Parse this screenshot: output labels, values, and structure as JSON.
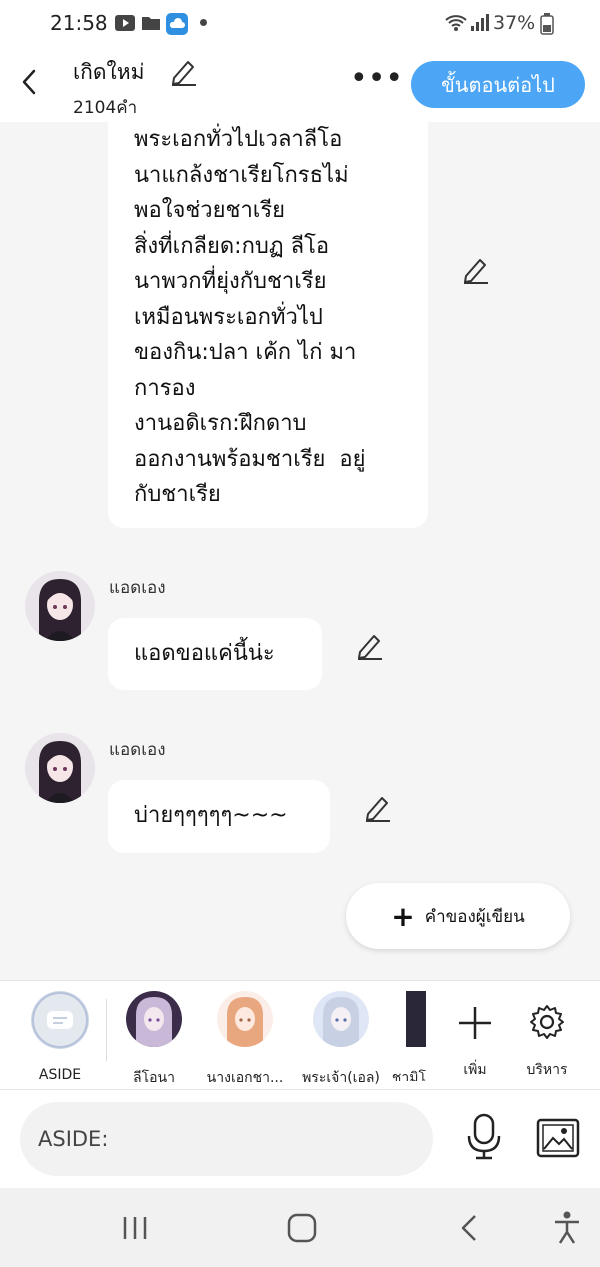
{
  "status_bar": {
    "time": "21:58",
    "battery": "37%",
    "icons": [
      "youtube-icon",
      "folder-icon",
      "cloud-icon",
      "wifi-icon",
      "signal-icon",
      "battery-icon"
    ]
  },
  "header": {
    "title": "เกิดใหม่",
    "count": "2104คำ",
    "more_label": "•••",
    "next_button": "ขั้นตอนต่อไป"
  },
  "messages": [
    {
      "text": "พระเอกทั่วไปเวลาลีโอ\nนาแกล้งชาเรียโกรธไม่\nพอใจช่วยชาเรีย\nสิ่งที่เกลียด:กบฏ ลีโอ\nนาพวกที่ยุ่งกับชาเรีย\nเหมือนพระเอกทั่วไป\nของกิน:ปลา เค้ก ไก่ มา\nการอง\nงานอดิเรก:ฝึกดาบ\nออกงานพร้อมชาเรีย  อยู่\nกับชาเรีย"
    },
    {
      "sender": "แอดเอง",
      "text": "แอดขอแค่นี้น่ะ"
    },
    {
      "sender": "แอดเอง",
      "text": "บ่ายๆๆๆๆๆ~~~"
    }
  ],
  "add_comment": {
    "label": "คำของผู้เขียน"
  },
  "characters": [
    {
      "label": "ASIDE"
    },
    {
      "label": "ลีโอนา"
    },
    {
      "label": "นางเอกชา..."
    },
    {
      "label": "พระเจ้า(เอล)"
    },
    {
      "label": "ชามิโ"
    }
  ],
  "char_actions": {
    "add_label": "เพิ่ม",
    "manage_label": "บริหาร"
  },
  "input": {
    "placeholder": "ASIDE:"
  },
  "colors": {
    "accent": "#4ca6f5",
    "background": "#f5f5f5",
    "bubble": "#ffffff"
  }
}
